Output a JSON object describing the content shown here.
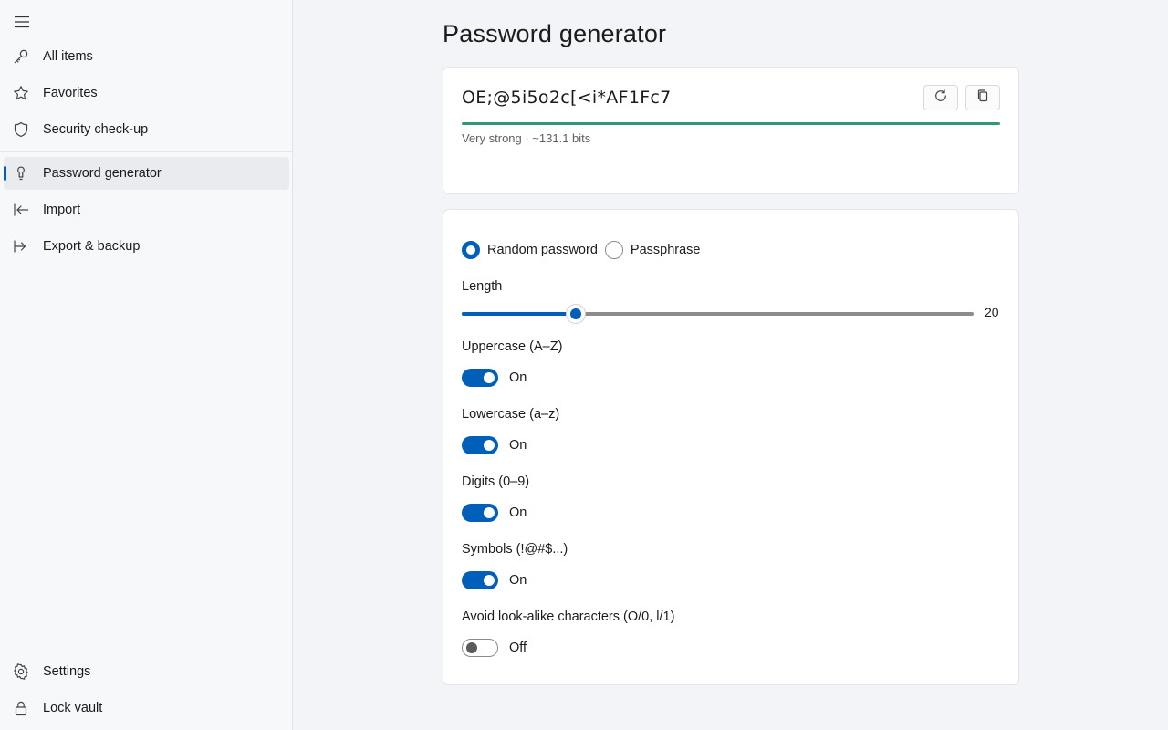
{
  "sidebar": {
    "menu_icon": "hamburger-icon",
    "items": [
      {
        "label": "All items",
        "icon": "key-icon"
      },
      {
        "label": "Favorites",
        "icon": "star-icon"
      },
      {
        "label": "Security check-up",
        "icon": "shield-icon"
      },
      {
        "label": "Password generator",
        "icon": "generator-icon",
        "active": true
      },
      {
        "label": "Import",
        "icon": "import-arrow-icon"
      },
      {
        "label": "Export & backup",
        "icon": "export-arrow-icon"
      }
    ],
    "footer_items": [
      {
        "label": "Settings",
        "icon": "gear-icon"
      },
      {
        "label": "Lock vault",
        "icon": "lock-icon"
      }
    ]
  },
  "page": {
    "title": "Password generator"
  },
  "generator": {
    "password": "OE;@5i5o2c[<i*AF1Fc7",
    "strength_text": "Very strong · ~131.1 bits",
    "strength_fraction": 1.0,
    "strength_color": "#2e9a6f",
    "refresh_icon": "refresh-icon",
    "copy_icon": "copy-icon"
  },
  "options": {
    "mode_random": "Random password",
    "mode_passphrase": "Passphrase",
    "mode_selected": "random",
    "length_label": "Length",
    "length_value": "20",
    "length_fraction": 0.222,
    "toggles": [
      {
        "label": "Uppercase (A–Z)",
        "state": "On",
        "on": true
      },
      {
        "label": "Lowercase (a–z)",
        "state": "On",
        "on": true
      },
      {
        "label": "Digits (0–9)",
        "state": "On",
        "on": true
      },
      {
        "label": "Symbols (!@#$...)",
        "state": "On",
        "on": true
      },
      {
        "label": "Avoid look-alike characters (O/0, l/1)",
        "state": "Off",
        "on": false
      }
    ]
  },
  "colors": {
    "accent": "#005fb8",
    "strength": "#2e9a6f"
  }
}
